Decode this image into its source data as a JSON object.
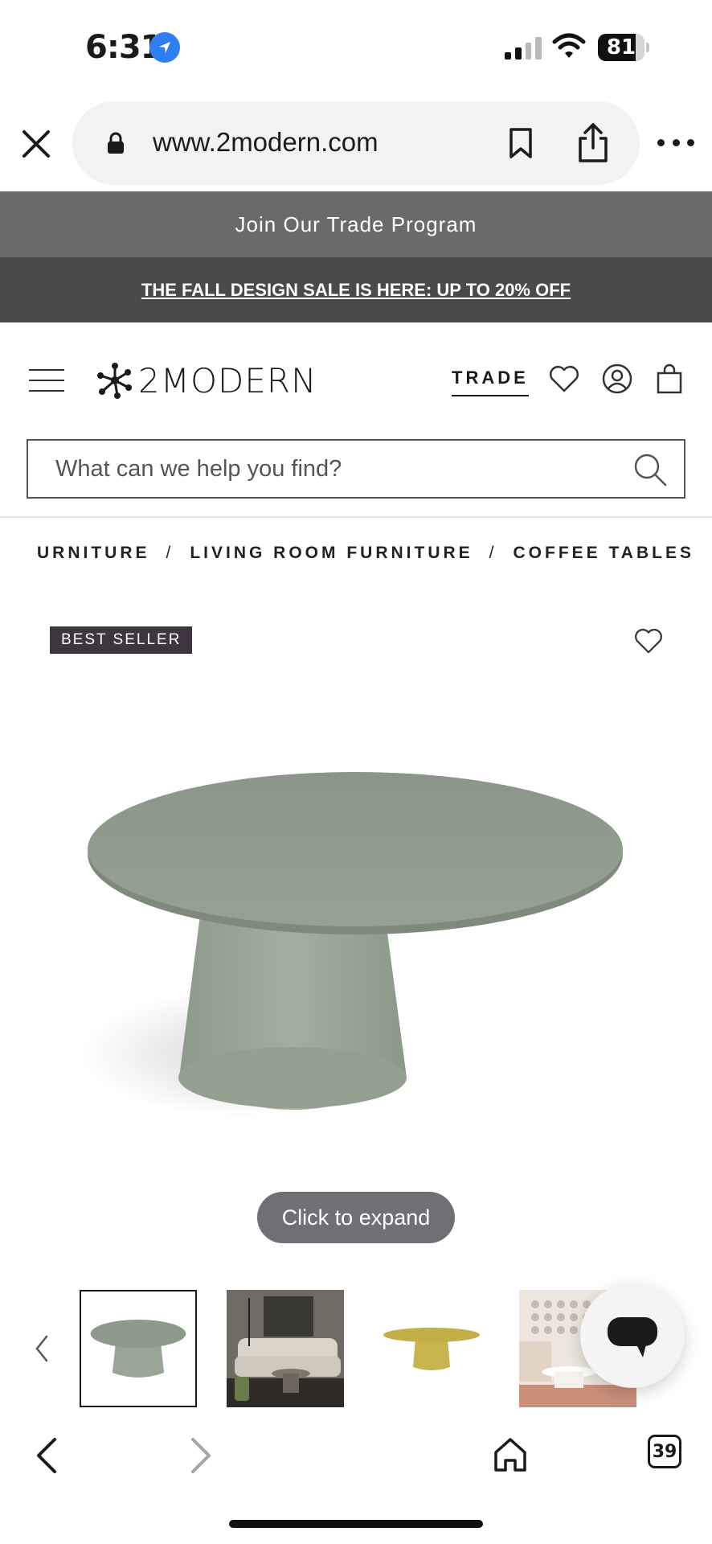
{
  "status_bar": {
    "time": "6:31",
    "battery": "81",
    "battery_fraction": 0.81
  },
  "browser": {
    "url": "www.2modern.com",
    "tab_count": "39"
  },
  "banners": {
    "trade": "Join Our Trade Program",
    "sale": "THE FALL DESIGN SALE IS HERE: UP TO 20% OFF"
  },
  "header": {
    "logo_text": "2MODERN",
    "trade_label": "TRADE"
  },
  "search": {
    "placeholder": "What can we help you find?"
  },
  "breadcrumb": {
    "items": [
      "URNITURE",
      "LIVING ROOM FURNITURE",
      "COFFEE TABLES"
    ],
    "separator": "/"
  },
  "product": {
    "badge": "BEST SELLER",
    "expand_label": "Click to expand",
    "color": "#8e9a8c"
  },
  "thumbnails": [
    {
      "name": "sage-table",
      "active": true
    },
    {
      "name": "living-room-scene",
      "active": false
    },
    {
      "name": "yellow-table",
      "active": false
    },
    {
      "name": "white-room-scene",
      "active": false
    }
  ],
  "colors": {
    "trade_banner": "#6a6a6a",
    "sale_banner": "#4a4a4a",
    "badge_bg": "#3e3540",
    "location_blue": "#2f7ff2"
  },
  "icons": [
    "close-icon",
    "lock-icon",
    "bookmark-icon",
    "share-icon",
    "more-icon",
    "hamburger-icon",
    "heart-icon",
    "user-icon",
    "bag-icon",
    "search-icon",
    "chat-icon",
    "back-icon",
    "forward-icon",
    "home-icon"
  ]
}
